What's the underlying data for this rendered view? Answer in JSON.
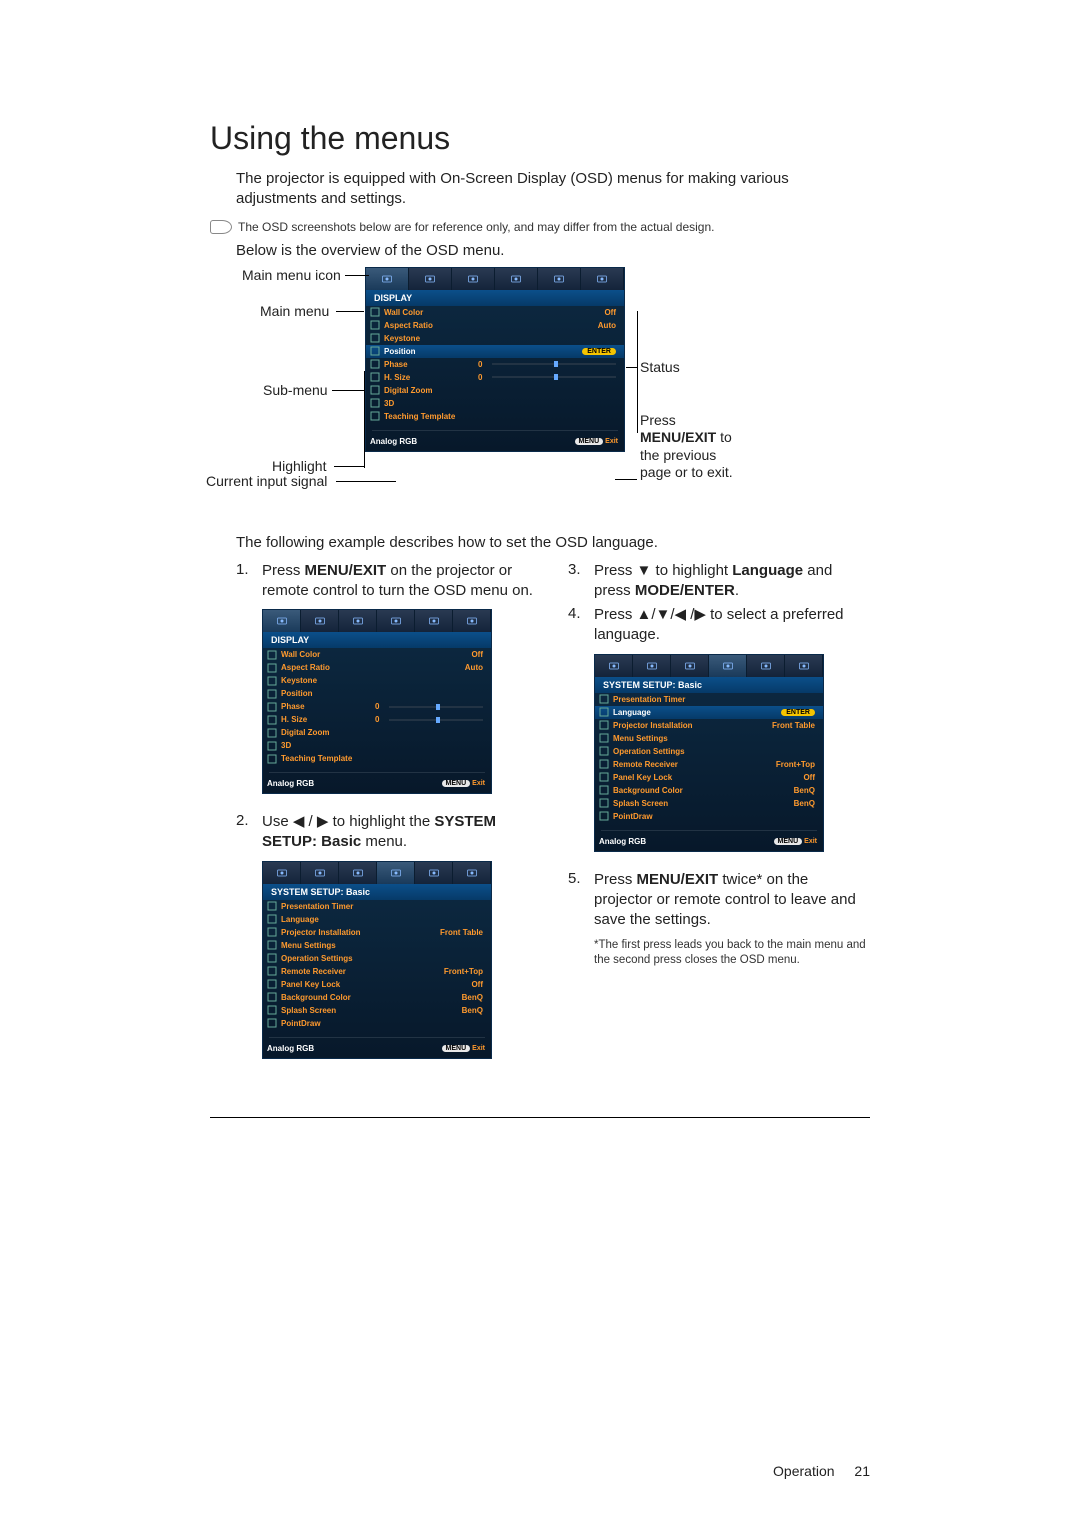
{
  "heading": "Using the menus",
  "intro": "The projector is equipped with On-Screen Display (OSD) menus for making various adjustments and settings.",
  "note": "The OSD screenshots below are for reference only, and may differ from the actual design.",
  "below": "Below is the overview of the OSD menu.",
  "labels": {
    "main_menu_icon": "Main menu icon",
    "main_menu": "Main menu",
    "sub_menu": "Sub-menu",
    "highlight": "Highlight",
    "current_input": "Current input signal",
    "status": "Status",
    "press_menu_exit_note_a": "Press ",
    "press_menu_exit_note_b": "MENU/EXIT",
    "press_menu_exit_note_c": " to the previous page or to exit."
  },
  "osd_display": {
    "title": "DISPLAY",
    "rows": [
      {
        "name": "Wall Color",
        "value": "Off"
      },
      {
        "name": "Aspect Ratio",
        "value": "Auto"
      },
      {
        "name": "Keystone",
        "value": ""
      },
      {
        "name": "Position",
        "enter": true,
        "hl": true
      },
      {
        "name": "Phase",
        "value": "0",
        "slider": true
      },
      {
        "name": "H. Size",
        "value": "0",
        "slider": true
      },
      {
        "name": "Digital Zoom",
        "value": ""
      },
      {
        "name": "3D",
        "value": ""
      },
      {
        "name": "Teaching Template",
        "value": ""
      }
    ],
    "signal": "Analog RGB",
    "exit_menu": "MENU",
    "exit_label": "Exit"
  },
  "example_intro": "The following example describes how to set the OSD language.",
  "step1_a": "Press ",
  "step1_b": "MENU/EXIT",
  "step1_c": " on the projector or remote control to turn the OSD menu on.",
  "step2_a": "Use ◀ / ▶ to highlight the ",
  "step2_b": "SYSTEM SETUP: Basic",
  "step2_c": " menu.",
  "step3_a": "Press ▼ to highlight ",
  "step3_b": "Language",
  "step3_c": " and press ",
  "step3_d": "MODE/ENTER",
  "step3_e": ".",
  "step4_a": "Press ▲/▼/◀ /▶ to select a preferred language.",
  "step5_a": "Press ",
  "step5_b": "MENU/EXIT",
  "step5_c": " twice* on the projector or remote control to leave and save the settings.",
  "footnote": "*The first press leads you back to the main menu and the second press closes the OSD menu.",
  "osd_system": {
    "title": "SYSTEM SETUP: Basic",
    "rows": [
      {
        "name": "Presentation Timer",
        "value": ""
      },
      {
        "name": "Language",
        "value": ""
      },
      {
        "name": "Projector Installation",
        "value": "Front Table"
      },
      {
        "name": "Menu Settings",
        "value": ""
      },
      {
        "name": "Operation Settings",
        "value": ""
      },
      {
        "name": "Remote Receiver",
        "value": "Front+Top"
      },
      {
        "name": "Panel Key Lock",
        "value": "Off"
      },
      {
        "name": "Background Color",
        "value": "BenQ"
      },
      {
        "name": "Splash Screen",
        "value": "BenQ"
      },
      {
        "name": "PointDraw",
        "value": ""
      }
    ],
    "signal": "Analog RGB",
    "exit_menu": "MENU",
    "exit_label": "Exit"
  },
  "osd_system_lang": {
    "title": "SYSTEM SETUP: Basic",
    "rows": [
      {
        "name": "Presentation Timer",
        "value": ""
      },
      {
        "name": "Language",
        "enter": true,
        "hl": true
      },
      {
        "name": "Projector Installation",
        "value": "Front Table"
      },
      {
        "name": "Menu Settings",
        "value": ""
      },
      {
        "name": "Operation Settings",
        "value": ""
      },
      {
        "name": "Remote Receiver",
        "value": "Front+Top"
      },
      {
        "name": "Panel Key Lock",
        "value": "Off"
      },
      {
        "name": "Background Color",
        "value": "BenQ"
      },
      {
        "name": "Splash Screen",
        "value": "BenQ"
      },
      {
        "name": "PointDraw",
        "value": ""
      }
    ],
    "signal": "Analog RGB",
    "exit_menu": "MENU",
    "exit_label": "Exit"
  },
  "nums": {
    "n1": "1.",
    "n2": "2.",
    "n3": "3.",
    "n4": "4.",
    "n5": "5."
  },
  "enter_label": "ENTER",
  "footer": {
    "section": "Operation",
    "page": "21"
  }
}
